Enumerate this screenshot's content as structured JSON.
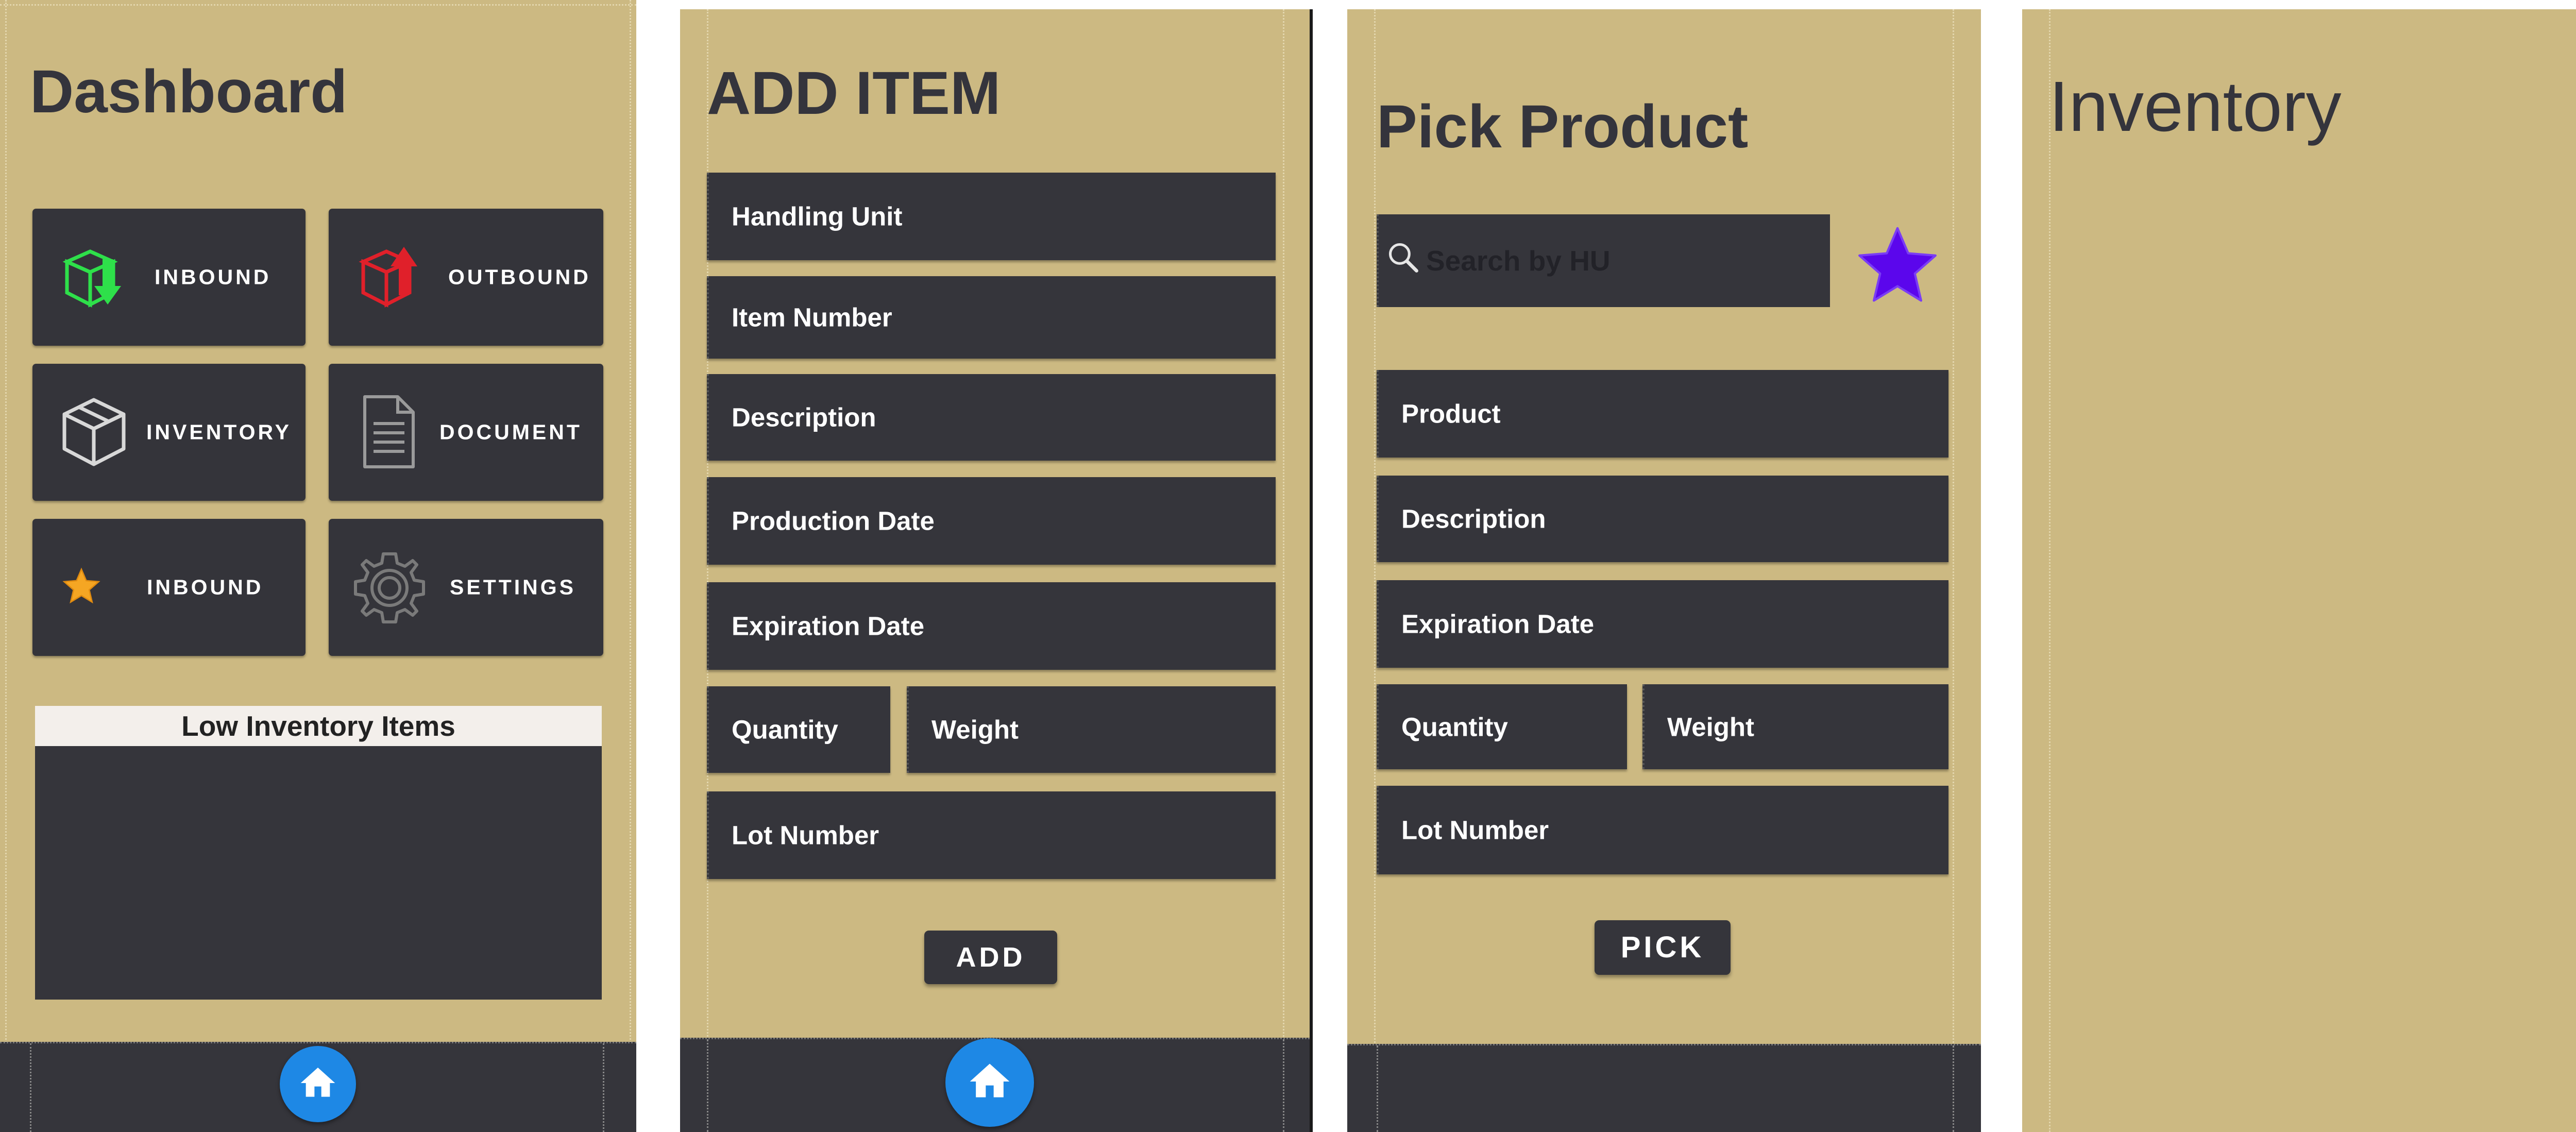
{
  "dashboard": {
    "title": "Dashboard",
    "tiles": [
      {
        "label": "INBOUND",
        "icon": "inbound-box-icon",
        "color": "#2ee04a"
      },
      {
        "label": "OUTBOUND",
        "icon": "outbound-box-icon",
        "color": "#e0202a"
      },
      {
        "label": "INVENTORY",
        "icon": "cube-icon",
        "color": "#d8d8d8"
      },
      {
        "label": "DOCUMENT",
        "icon": "document-icon",
        "color": "#9a9a9a"
      },
      {
        "label": "INBOUND",
        "icon": "star-icon",
        "color": "#f5a623"
      },
      {
        "label": "SETTINGS",
        "icon": "gear-icon",
        "color": "#7a7a7a"
      }
    ],
    "low_inventory_header": "Low Inventory Items"
  },
  "add_item": {
    "title": "ADD ITEM",
    "fields": {
      "handling_unit": "Handling Unit",
      "item_number": "Item Number",
      "description": "Description",
      "production_date": "Production Date",
      "expiration_date": "Expiration Date",
      "quantity": "Quantity",
      "weight": "Weight",
      "lot_number": "Lot Number"
    },
    "button": "ADD"
  },
  "pick_product": {
    "title": "Pick Product",
    "search_placeholder": "Search by HU",
    "star_color": "#5b06ec",
    "fields": {
      "product": "Product",
      "description": "Description",
      "expiration_date": "Expiration Date",
      "quantity": "Quantity",
      "weight": "Weight",
      "lot_number": "Lot Number"
    },
    "button": "PICK"
  },
  "inventory": {
    "title": "Inventory"
  },
  "colors": {
    "background": "#ccb982",
    "panel": "#35353b",
    "home_button": "#1e88e5"
  }
}
